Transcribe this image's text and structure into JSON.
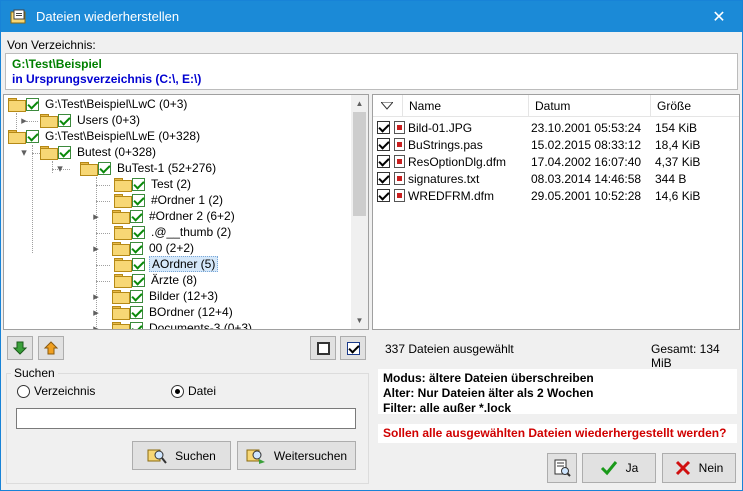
{
  "window": {
    "title": "Dateien wiederherstellen",
    "close_symbol": "✕"
  },
  "source": {
    "label": "Von Verzeichnis:",
    "line1": "G:\\Test\\Beispiel",
    "line2": "in Ursprungsverzeichnis (C:\\, E:\\)"
  },
  "tree": {
    "items": [
      {
        "label": "G:\\Test\\Beispiel\\LwC (0+3)",
        "checked": true,
        "expander": "▸"
      },
      {
        "label": "Users (0+3)",
        "checked": true,
        "expander": "▸"
      },
      {
        "label": "G:\\Test\\Beispiel\\LwE (0+328)",
        "checked": true,
        "expander": "▾"
      },
      {
        "label": "Butest (0+328)",
        "checked": true,
        "expander": "▾"
      },
      {
        "label": "BuTest-1 (52+276)",
        "checked": true,
        "expander": "▾"
      },
      {
        "label": "Test (2)",
        "checked": true,
        "expander": ""
      },
      {
        "label": "#Ordner 1 (2)",
        "checked": true,
        "expander": ""
      },
      {
        "label": "#Ordner 2 (6+2)",
        "checked": true,
        "expander": "▸"
      },
      {
        "label": ".@__thumb (2)",
        "checked": true,
        "expander": ""
      },
      {
        "label": "00 (2+2)",
        "checked": true,
        "expander": "▸"
      },
      {
        "label": "AOrdner (5)",
        "checked": true,
        "expander": "",
        "selected": true
      },
      {
        "label": "Ärzte (8)",
        "checked": true,
        "expander": ""
      },
      {
        "label": "Bilder (12+3)",
        "checked": true,
        "expander": "▸"
      },
      {
        "label": "BOrdner (12+4)",
        "checked": true,
        "expander": "▸"
      },
      {
        "label": "Documents-3 (0+3)",
        "checked": true,
        "expander": "▸"
      }
    ]
  },
  "filelist": {
    "columns": [
      "Name",
      "Datum",
      "Größe"
    ],
    "rows": [
      {
        "name": "Bild-01.JPG",
        "date": "23.10.2001 05:53:24",
        "size": "154 KiB"
      },
      {
        "name": "BuStrings.pas",
        "date": "15.02.2015 08:33:12",
        "size": "18,4 KiB"
      },
      {
        "name": "ResOptionDlg.dfm",
        "date": "17.04.2002 16:07:40",
        "size": "4,37 KiB"
      },
      {
        "name": "signatures.txt",
        "date": "08.03.2014 14:46:58",
        "size": "344 B"
      },
      {
        "name": "WREDFRM.dfm",
        "date": "29.05.2001 10:52:28",
        "size": "14,6 KiB"
      }
    ]
  },
  "status": {
    "selected_files": "337 Dateien ausgewählt",
    "total": "Gesamt:  134 MiB"
  },
  "search": {
    "group_label": "Suchen",
    "radio_dir": "Verzeichnis",
    "radio_file": "Datei",
    "selected_radio": "Datei",
    "input_value": "",
    "search_button": "Suchen",
    "continue_button": "Weitersuchen"
  },
  "info": {
    "line1": "Modus: ältere Dateien überschreiben",
    "line2": "Alter: Nur Dateien älter als 2 Wochen",
    "line3": "Filter: alle außer *.lock",
    "question": "Sollen alle ausgewählten Dateien wiederhergestellt werden?"
  },
  "buttons": {
    "yes": "Ja",
    "no": "Nein"
  },
  "colors": {
    "titlebar": "#1b8ad7",
    "source_green": "#008000",
    "source_blue": "#0000d0",
    "question_red": "#d00000"
  }
}
